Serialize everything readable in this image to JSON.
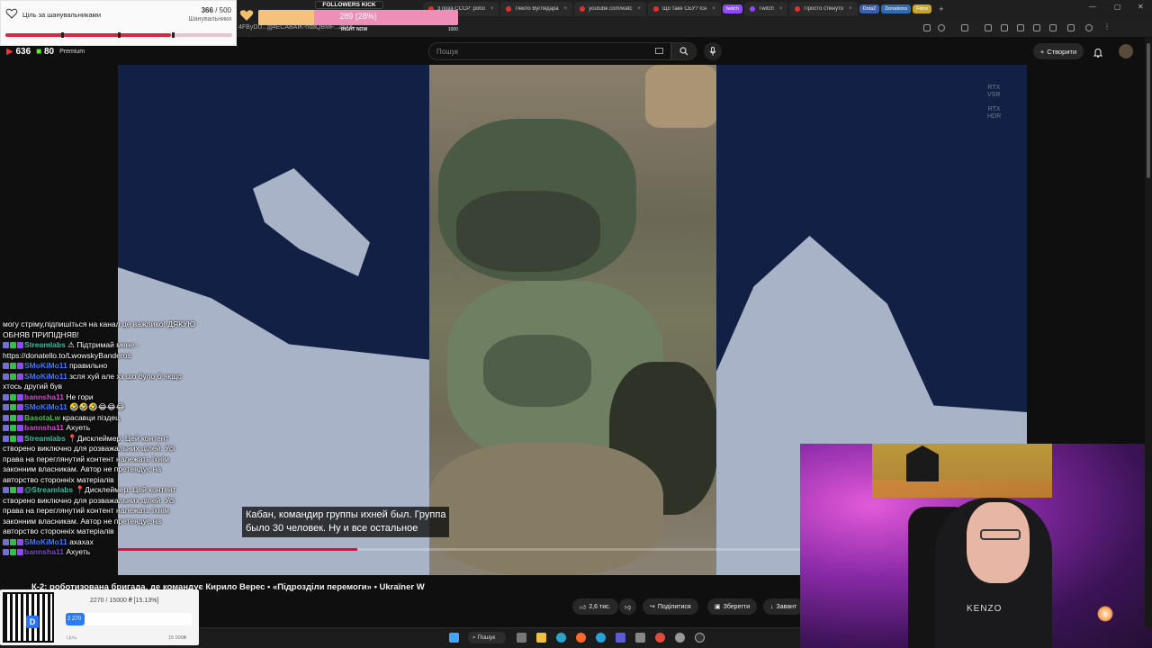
{
  "browser": {
    "tabs": [
      {
        "label": "3 поза СССР: робо"
      },
      {
        "label": "Пекло Вуглядара"
      },
      {
        "label": "youtube.com/watc"
      },
      {
        "label": "Що таке СБУ? Існ"
      },
      {
        "label": "Twitch"
      },
      {
        "label": "Просто стікнуто"
      }
    ],
    "tab_pills": [
      {
        "label": "twitch",
        "color": "#9147ff"
      },
      {
        "label": "Dota2",
        "color": "#3a5fb0"
      },
      {
        "label": "Donations",
        "color": "#2c6db8"
      },
      {
        "label": "Films",
        "color": "#c7a62a"
      }
    ],
    "url": "4FByDU...jg4ECABAIK-ndaQBMF...2xYK",
    "window_controls": [
      "—",
      "▢",
      "✕"
    ]
  },
  "youtube": {
    "search_placeholder": "Пошук",
    "create_label": "Створити",
    "logo_text": "Premium"
  },
  "video": {
    "badges": {
      "top1": "RTX",
      "top1b": "VSR",
      "top2": "RTX",
      "top2b": "HDR"
    },
    "subtitle_line1": "Кабан, командир группы ихней был. Группа",
    "subtitle_line2": "было 30 человек. Ну и все остальное",
    "progress_fraction": 0.35,
    "title": "К-2: роботизована бригада, де командує Кирило Верес • «Підрозділи перемоги» • Ukraïner W"
  },
  "actions": [
    {
      "label": "2,6 тис.",
      "icon": "thumbs-up-icon"
    },
    {
      "label": "",
      "icon": "thumbs-down-icon"
    },
    {
      "label": "Поділитися",
      "icon": "share-icon"
    },
    {
      "label": "Зберегти",
      "icon": "save-icon"
    },
    {
      "label": "Завант",
      "icon": "download-icon"
    }
  ],
  "goal_widget": {
    "title": "Ціль за шанувальниками",
    "current": "366",
    "target": "500",
    "count_text": "366 / 500",
    "subtitle": "Шанувальники",
    "fraction": 0.732
  },
  "followers_kick": {
    "label": "FOLLOWERS KICK",
    "progress_text": "289 (28%)",
    "fraction": 0.28,
    "left_text": "RIGHT NOW",
    "right_text": "1000"
  },
  "viewers": {
    "count_a": "636",
    "count_b": "80"
  },
  "chat": [
    {
      "user": "",
      "text": "могу стріму,підпишіться на канал це важливо! ДЯКУЮ ОБНЯВ ПРИПІДНЯВ!",
      "cls": ""
    },
    {
      "user": "Streamlabs",
      "text": "⚠ Підтримай мене - https://donatello.to/LwowskyBanderos",
      "cls": "u-streamlabs"
    },
    {
      "user": "SMoKiMo11",
      "text": "правильно",
      "cls": "u-smokimo"
    },
    {
      "user": "SMoKiMo11",
      "text": "зсля хуй але хз шо було б якщо хтось другий був",
      "cls": "u-smokimo"
    },
    {
      "user": "bannsha11",
      "text": "Не гори",
      "cls": "u-bannsha"
    },
    {
      "user": "SMoKiMo11",
      "text": "🤣🤣🤣😂😂😂",
      "cls": "u-smokimo"
    },
    {
      "user": "BasotaLw",
      "text": "красавци піздец",
      "cls": "u-basota"
    },
    {
      "user": "bannsha11",
      "text": "Ахуеть",
      "cls": "u-bannsha"
    },
    {
      "user": "Streamlabs",
      "text": "📍Дисклеймер: Цей контент створено виключно для розважальних цілей. Усі права на переглянутий контент належать їхнім законним власникам. Автор не претендує на авторство сторонніх матеріалів",
      "cls": "u-streamlabs"
    },
    {
      "user": "@Streamlabs",
      "text": "📍Дисклеймер: Цей контент створено виключно для розважальних цілей. Усі права на переглянутий контент належать їхнім законним власникам. Автор не претендує на авторство сторонніх матеріалів",
      "cls": "u-streamlabs"
    },
    {
      "user": "SMoKiMo11",
      "text": "ахахах",
      "cls": "u-smokimo"
    },
    {
      "user": "bannsha11",
      "text": "Ахуеть",
      "cls": "u-faded"
    }
  ],
  "donation": {
    "text": "2270 / 15000 ₴ [15.13%]",
    "amount_label": "2 270",
    "left": "Ціль",
    "right": "15 000₴",
    "fraction": 0.1513,
    "qr_logo": "D"
  },
  "webcam": {
    "hoodie_text": "KENZO"
  },
  "taskbar": {
    "search_label": "Пошук"
  }
}
